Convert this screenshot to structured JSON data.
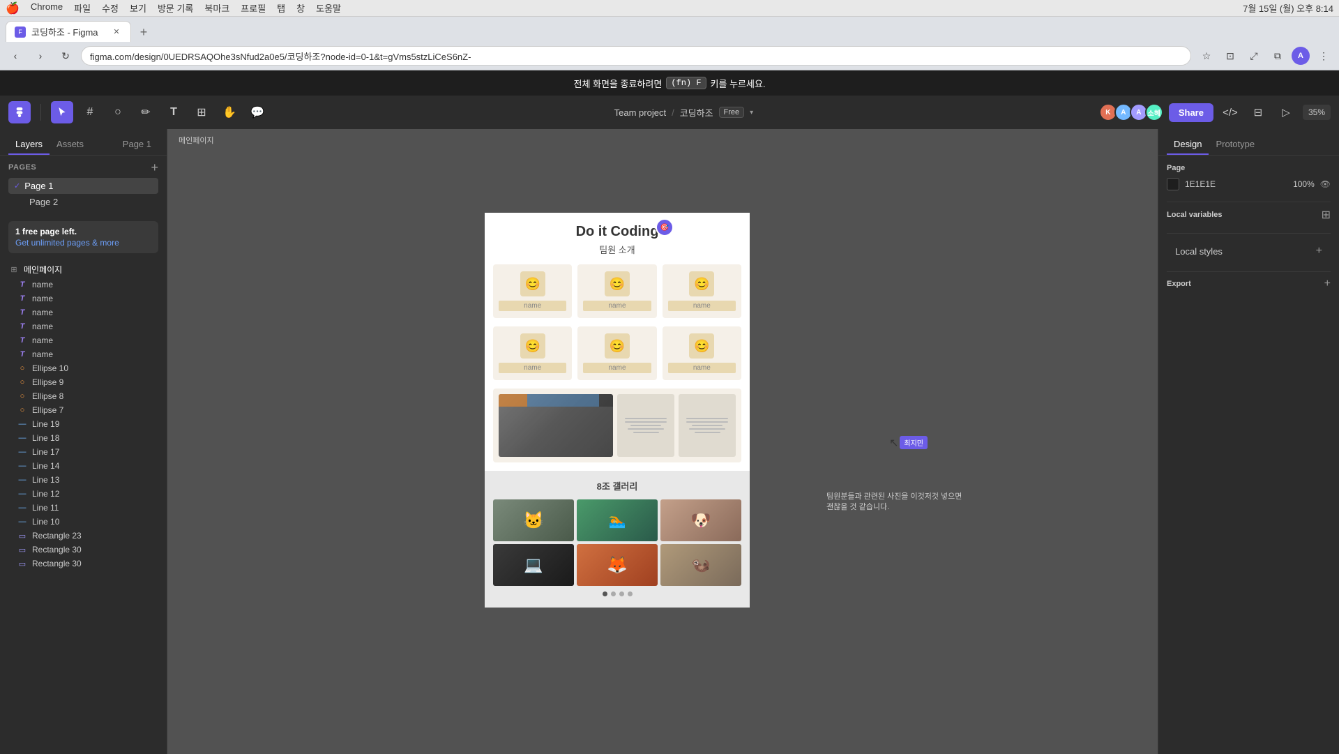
{
  "macos": {
    "logo": "🍎",
    "menu_items": [
      "Chrome",
      "파일",
      "수정",
      "보기",
      "방문 기록",
      "북마크",
      "프로필",
      "탭",
      "창",
      "도움말"
    ],
    "time": "7월 15일 (월) 오후 8:14"
  },
  "browser": {
    "tab_title": "코딩하조 - Figma",
    "tab_favicon": "F",
    "address": "figma.com/design/0UEDRSAQOhe3sNfud2a0e5/코딩하조?node-id=0-1&t=gVms5stzLiCeS6nZ-",
    "new_tab_label": "+"
  },
  "figma_banner": {
    "text_before": "전체 화면을 종료하려면",
    "shortcut": "(fn) F",
    "text_after": "키를 누르세요."
  },
  "figma_toolbar": {
    "team_project": "Team project",
    "separator": "/",
    "project_name": "코딩하조",
    "free_tag": "Free",
    "share_btn": "Share",
    "zoom_level": "35%",
    "tools": [
      {
        "name": "move",
        "icon": "▷",
        "active": true
      },
      {
        "name": "frame",
        "icon": "⬜"
      },
      {
        "name": "shape",
        "icon": "○"
      },
      {
        "name": "pen",
        "icon": "✏"
      },
      {
        "name": "text",
        "icon": "T"
      },
      {
        "name": "component",
        "icon": "⊞"
      },
      {
        "name": "hand",
        "icon": "✋"
      },
      {
        "name": "comment",
        "icon": "💬"
      }
    ]
  },
  "left_sidebar": {
    "tabs": [
      "Layers",
      "Assets"
    ],
    "active_tab": "Layers",
    "page_tab": "Page 1",
    "pages_title": "Pages",
    "pages": [
      {
        "name": "Page 1",
        "active": true
      },
      {
        "name": "Page 2",
        "active": false
      }
    ],
    "free_notice": {
      "title": "1 free page left.",
      "link_text": "Get unlimited pages & more"
    },
    "layers": [
      {
        "type": "group",
        "icon": "⊞",
        "name": "메인페이지",
        "indent": 0
      },
      {
        "type": "text",
        "icon": "T",
        "name": "name",
        "indent": 1
      },
      {
        "type": "text",
        "icon": "T",
        "name": "name",
        "indent": 1
      },
      {
        "type": "text",
        "icon": "T",
        "name": "name",
        "indent": 1
      },
      {
        "type": "text",
        "icon": "T",
        "name": "name",
        "indent": 1
      },
      {
        "type": "text",
        "icon": "T",
        "name": "name",
        "indent": 1
      },
      {
        "type": "text",
        "icon": "T",
        "name": "name",
        "indent": 1
      },
      {
        "type": "circle",
        "icon": "○",
        "name": "Ellipse 10",
        "indent": 1
      },
      {
        "type": "circle",
        "icon": "○",
        "name": "Ellipse 9",
        "indent": 1
      },
      {
        "type": "circle",
        "icon": "○",
        "name": "Ellipse 8",
        "indent": 1
      },
      {
        "type": "circle",
        "icon": "○",
        "name": "Ellipse 7",
        "indent": 1
      },
      {
        "type": "line",
        "icon": "—",
        "name": "Line 19",
        "indent": 1
      },
      {
        "type": "line",
        "icon": "—",
        "name": "Line 18",
        "indent": 1
      },
      {
        "type": "line",
        "icon": "—",
        "name": "Line 17",
        "indent": 1
      },
      {
        "type": "line",
        "icon": "—",
        "name": "Line 14",
        "indent": 1
      },
      {
        "type": "line",
        "icon": "—",
        "name": "Line 13",
        "indent": 1
      },
      {
        "type": "line",
        "icon": "—",
        "name": "Line 12",
        "indent": 1
      },
      {
        "type": "line",
        "icon": "—",
        "name": "Line 11",
        "indent": 1
      },
      {
        "type": "line",
        "icon": "—",
        "name": "Line 10",
        "indent": 1
      },
      {
        "type": "rect",
        "icon": "▭",
        "name": "Rectangle 23",
        "indent": 1
      },
      {
        "type": "rect",
        "icon": "▭",
        "name": "Rectangle 30",
        "indent": 1
      },
      {
        "type": "rect",
        "icon": "▭",
        "name": "Rectangle 30",
        "indent": 1
      }
    ]
  },
  "canvas": {
    "frame_label": "메인페이지",
    "page_title": "Do it Coding",
    "team_section_title": "팀원 소개",
    "member_name": "name",
    "emoji_avatar": "😊",
    "gallery_section_title": "8조 갤러리",
    "gallery_dots_count": 4,
    "annotation_text": "팀원분들과 관련된 사진을 이것저것 넣으면 괜찮을 것 같습니다.",
    "cursor_comment_text": "최지민"
  },
  "right_sidebar": {
    "tabs": [
      "Design",
      "Prototype"
    ],
    "active_tab": "Design",
    "page_section": {
      "title": "Page",
      "color_hex": "1E1E1E",
      "opacity": "100%",
      "eye_icon": "👁"
    },
    "local_variables": {
      "title": "Local variables",
      "add_icon": "⊞"
    },
    "local_styles": {
      "title": "Local styles",
      "add_icon": "+"
    },
    "export_section": {
      "title": "Export",
      "add_icon": "+"
    }
  }
}
